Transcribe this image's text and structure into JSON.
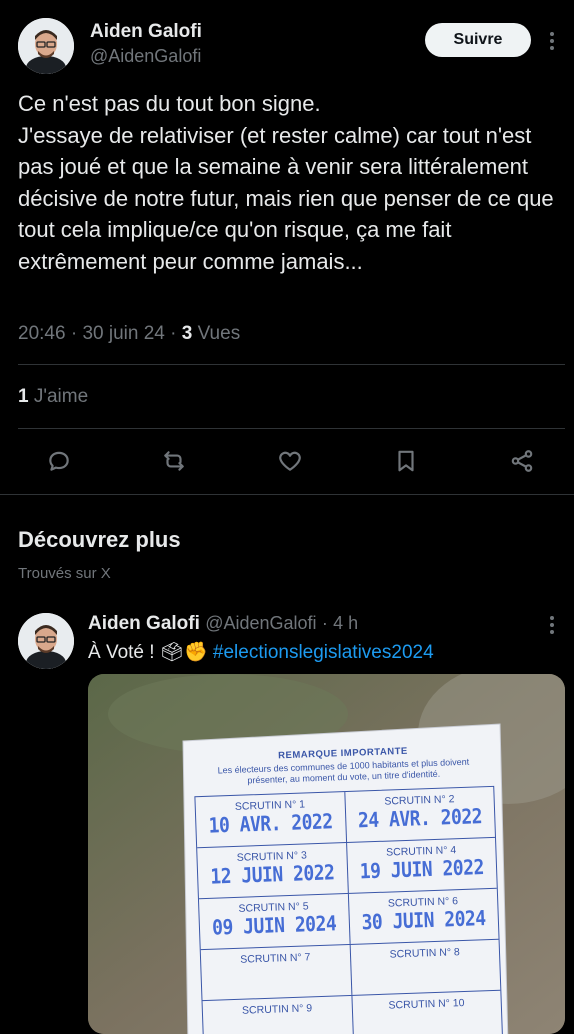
{
  "tweet": {
    "author_name": "Aiden Galofi",
    "author_handle": "@AidenGalofi",
    "follow_label": "Suivre",
    "text": "Ce n'est pas du tout bon signe.\nJ'essaye de relativiser (et rester calme) car tout n'est pas joué et que la semaine à venir sera littéralement décisive de notre futur, mais rien que penser de ce que tout cela implique/ce qu'on risque, ça me fait extrêmement peur comme jamais...",
    "time": "20:46",
    "date": "30 juin 24",
    "separator": "·",
    "views_count": "3",
    "views_label": "Vues",
    "likes_count": "1",
    "likes_label": "J'aime",
    "actions": [
      "reply-icon",
      "retweet-icon",
      "like-icon",
      "bookmark-icon",
      "share-icon"
    ]
  },
  "discover": {
    "title": "Découvrez plus",
    "subtitle": "Trouvés sur X"
  },
  "related_tweet": {
    "author_name": "Aiden Galofi",
    "author_handle": "@AidenGalofi",
    "age": "4 h",
    "text_prefix": "À Voté ! ",
    "emojis": "🗳✊",
    "hashtag": "#electionslegislatives2024",
    "card": {
      "title": "REMARQUE IMPORTANTE",
      "notice": "Les électeurs des communes de 1000 habitants et plus doivent présenter, au moment du vote, un titre d'identité.",
      "rows": [
        [
          {
            "label": "SCRUTIN N° 1",
            "stamp": "10 AVR. 2022"
          },
          {
            "label": "SCRUTIN N° 2",
            "stamp": "24 AVR. 2022"
          }
        ],
        [
          {
            "label": "SCRUTIN N° 3",
            "stamp": "12 JUIN 2022"
          },
          {
            "label": "SCRUTIN N° 4",
            "stamp": "19 JUIN 2022"
          }
        ],
        [
          {
            "label": "SCRUTIN N° 5",
            "stamp": "09 JUIN 2024"
          },
          {
            "label": "SCRUTIN N° 6",
            "stamp": "30 JUIN 2024"
          }
        ],
        [
          {
            "label": "SCRUTIN N° 7",
            "stamp": ""
          },
          {
            "label": "SCRUTIN N° 8",
            "stamp": ""
          }
        ],
        [
          {
            "label": "SCRUTIN N° 9",
            "stamp": ""
          },
          {
            "label": "SCRUTIN N° 10",
            "stamp": ""
          }
        ]
      ]
    }
  },
  "colors": {
    "background": "#000000",
    "text": "#e7e9ea",
    "muted": "#71767b",
    "accent": "#1d9bf0",
    "divider": "#2f3336",
    "stamp": "#2f5bd1"
  }
}
